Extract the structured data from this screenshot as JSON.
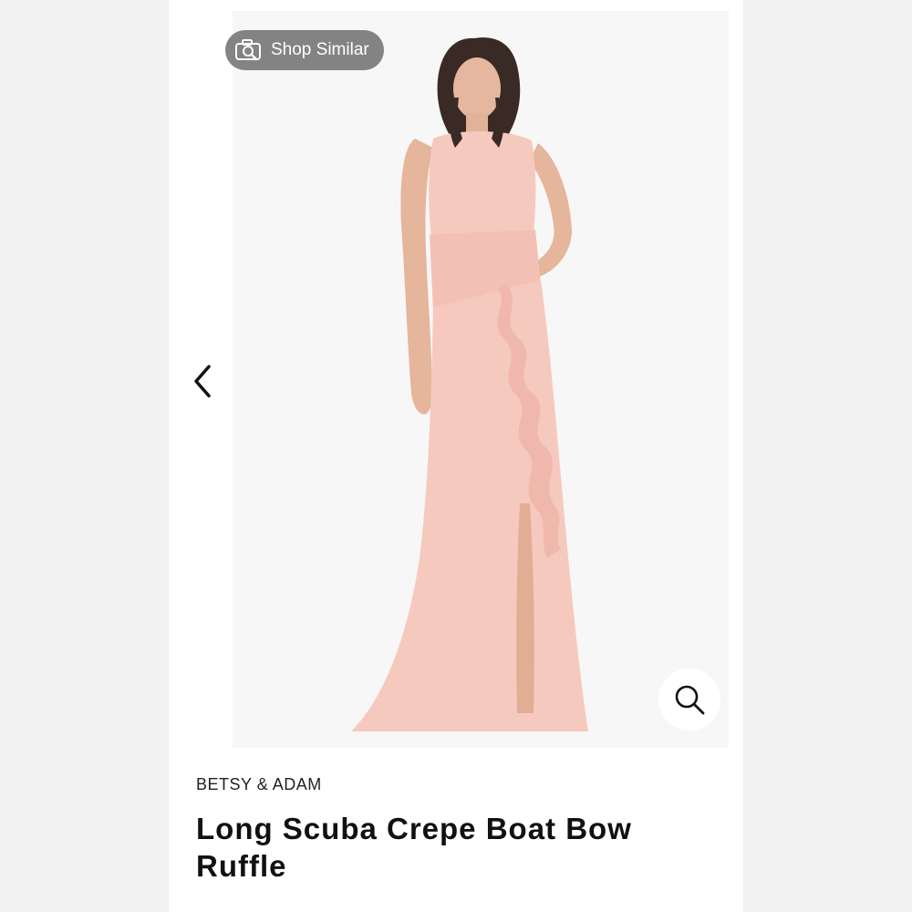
{
  "actions": {
    "shop_similar_label": "Shop Similar"
  },
  "product": {
    "brand": "BETSY & ADAM",
    "title": "Long Scuba Crepe Boat Bow Ruffle",
    "dress_color": "#f6c9bf"
  },
  "icons": {
    "shop_similar": "camera-search-icon",
    "prev": "chevron-left-icon",
    "zoom": "magnifier-icon"
  }
}
